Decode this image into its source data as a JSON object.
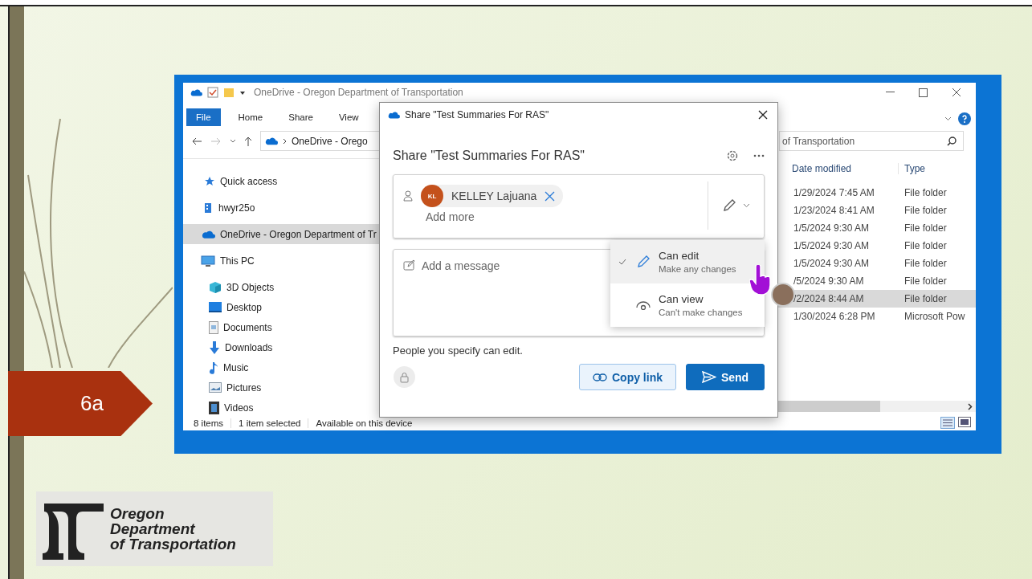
{
  "slide": {
    "label": "6a",
    "logo_lines": [
      "Oregon",
      "Department",
      "of Transportation"
    ]
  },
  "explorer": {
    "title": "OneDrive - Oregon Department of Transportation",
    "ribbon_tabs": [
      {
        "label": "File",
        "selected": true
      },
      {
        "label": "Home",
        "selected": false
      },
      {
        "label": "Share",
        "selected": false
      },
      {
        "label": "View",
        "selected": false
      }
    ],
    "address": "OneDrive - Orego",
    "search": {
      "placeholder": "of Transportation"
    },
    "nav": [
      {
        "label": "Quick access",
        "selected": false
      },
      {
        "label": "hwyr25o",
        "selected": false
      },
      {
        "label": "OneDrive - Oregon Department of Tr",
        "selected": true
      },
      {
        "label": "This PC",
        "selected": false,
        "children": [
          {
            "label": "3D Objects",
            "selected": false
          },
          {
            "label": "Desktop",
            "selected": false
          },
          {
            "label": "Documents",
            "selected": false
          },
          {
            "label": "Downloads",
            "selected": false
          },
          {
            "label": "Music",
            "selected": false
          },
          {
            "label": "Pictures",
            "selected": false
          },
          {
            "label": "Videos",
            "selected": false
          }
        ]
      }
    ],
    "columns": [
      "Date modified",
      "Type"
    ],
    "rows": [
      {
        "date": "1/29/2024 7:45 AM",
        "type": "File folder",
        "selected": false
      },
      {
        "date": "1/23/2024 8:41 AM",
        "type": "File folder",
        "selected": false
      },
      {
        "date": "1/5/2024 9:30 AM",
        "type": "File folder",
        "selected": false
      },
      {
        "date": "1/5/2024 9:30 AM",
        "type": "File folder",
        "selected": false
      },
      {
        "date": "1/5/2024 9:30 AM",
        "type": "File folder",
        "selected": false
      },
      {
        "date": "/5/2024 9:30 AM",
        "type": "File folder",
        "selected": false
      },
      {
        "date": "/2/2024 8:44 AM",
        "type": "File folder",
        "selected": true
      },
      {
        "date": "1/30/2024 6:28 PM",
        "type": "Microsoft Pow",
        "selected": false
      }
    ],
    "status": [
      "8 items",
      "1 item selected",
      "Available on this device"
    ]
  },
  "share_dialog": {
    "window_title": "Share \"Test Summaries For RAS\"",
    "heading": "Share \"Test Summaries For RAS\"",
    "recipient": {
      "initials": "KL",
      "name": "KELLEY Lajuana"
    },
    "add_more_placeholder": "Add more",
    "message_placeholder": "Add a message",
    "permission_menu": [
      {
        "title": "Can edit",
        "subtitle": "Make any changes",
        "selected": true
      },
      {
        "title": "Can view",
        "subtitle": "Can't make changes",
        "selected": false
      }
    ],
    "note": "People you specify can edit.",
    "buttons": [
      {
        "label": "Copy link",
        "kind": "secondary"
      },
      {
        "label": "Send",
        "kind": "primary"
      }
    ]
  }
}
